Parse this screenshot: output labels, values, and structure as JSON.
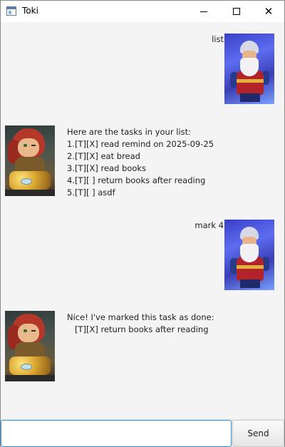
{
  "window": {
    "title": "Toki"
  },
  "titlebar": {
    "minimize_icon": "minimize-icon",
    "maximize_icon": "maximize-icon",
    "close_icon": "close-icon",
    "close_glyph": "✕"
  },
  "messages": [
    {
      "sender": "user",
      "text": "list",
      "avatar": "wizard-avatar"
    },
    {
      "sender": "bot",
      "text": "Here are the tasks in your list:\n1.[T][X] read remind on 2025-09-25\n2.[T][X] eat bread\n3.[T][X] read books\n4.[T][ ] return books after reading\n5.[T][ ] asdf",
      "avatar": "dwarf-avatar"
    },
    {
      "sender": "user",
      "text": "mark 4",
      "avatar": "wizard-avatar"
    },
    {
      "sender": "bot",
      "text": "Nice! I've marked this task as done:\n   [T][X] return books after reading",
      "avatar": "dwarf-avatar"
    }
  ],
  "input": {
    "value": "",
    "placeholder": ""
  },
  "send_button": {
    "label": "Send"
  },
  "colors": {
    "accent": "#2a8fd6",
    "background": "#f4f4f4"
  }
}
